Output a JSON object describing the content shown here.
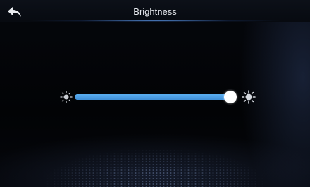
{
  "header": {
    "title": "Brightness",
    "back_icon": "back-arrow-icon"
  },
  "brightness_slider": {
    "level_fraction": 1.0,
    "min_icon": "sun-dim-icon",
    "max_icon": "sun-bright-icon"
  },
  "colors": {
    "accent": "#4a9fe6",
    "background": "#000000",
    "title_text": "#e6e9ee",
    "thumb": "#ffffff",
    "icon": "#c8ccd2"
  }
}
